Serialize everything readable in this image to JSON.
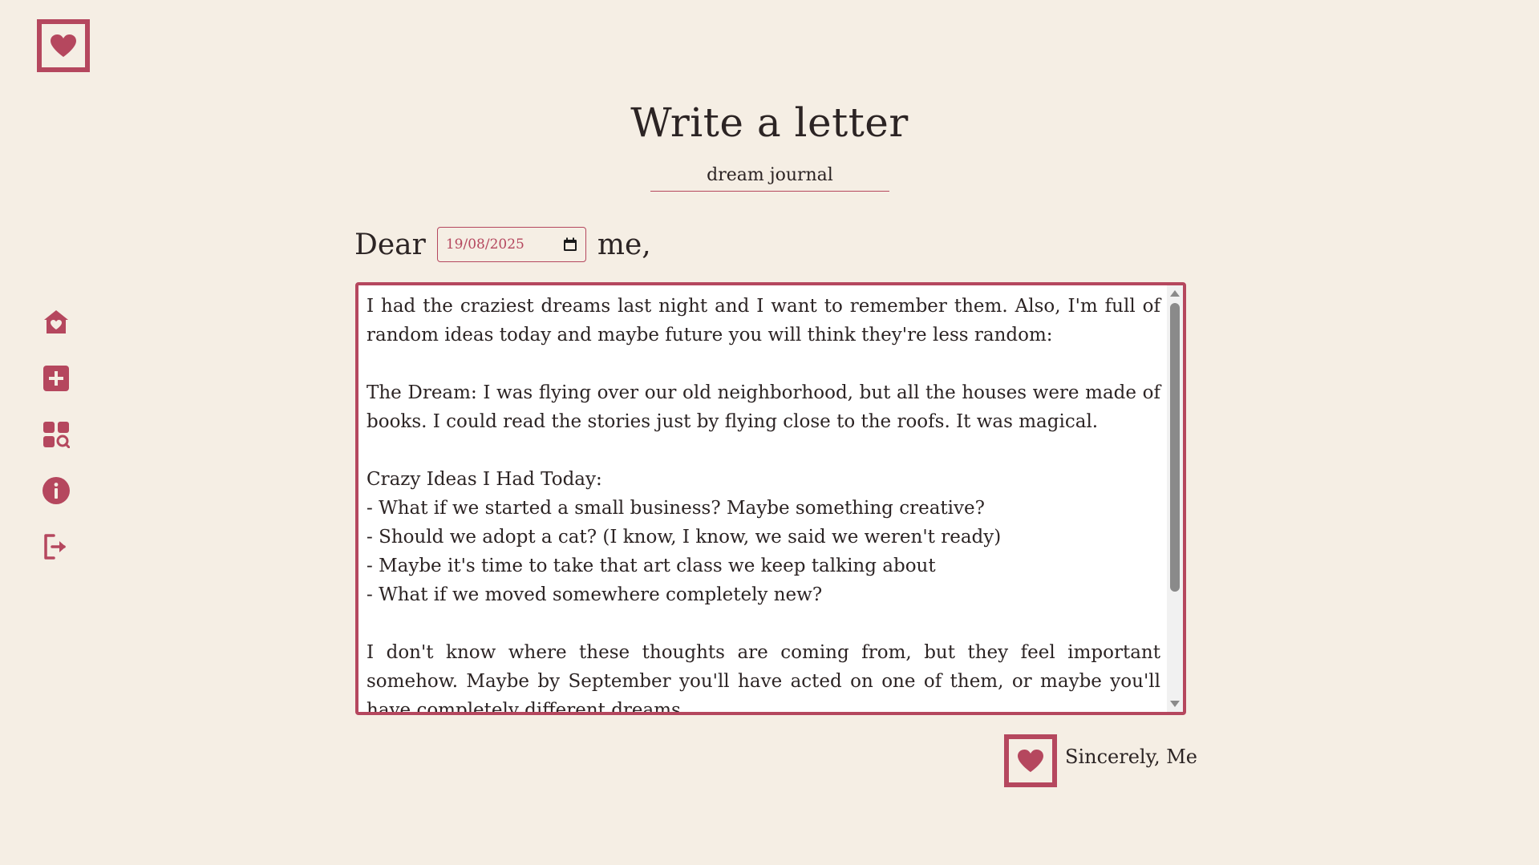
{
  "app": {
    "logo_icon": "heart-stamp-icon",
    "accent_color": "#b5475e",
    "background_color": "#f5eee4"
  },
  "sidebar": {
    "items": [
      {
        "icon": "home-heart-icon",
        "label": "Home"
      },
      {
        "icon": "add-square-icon",
        "label": "New letter"
      },
      {
        "icon": "grid-search-icon",
        "label": "Browse letters"
      },
      {
        "icon": "info-icon",
        "label": "About"
      },
      {
        "icon": "logout-icon",
        "label": "Log out"
      }
    ]
  },
  "header": {
    "title": "Write a letter",
    "subject_value": "dream journal"
  },
  "salutation": {
    "dear_text": "Dear",
    "date_value": "19/08/2025",
    "recipient_text": "me,"
  },
  "letter": {
    "body": "I had the craziest dreams last night and I want to remember them. Also, I'm full of random ideas today and maybe future you will think they're less random:\n\nThe Dream: I was flying over our old neighborhood, but all the houses were made of books. I could read the stories just by flying close to the roofs. It was magical.\n\nCrazy Ideas I Had Today:\n- What if we started a small business? Maybe something creative?\n- Should we adopt a cat? (I know, I know, we said we weren't ready)\n- Maybe it's time to take that art class we keep talking about\n- What if we moved somewhere completely new?\n\nI don't know where these thoughts are coming from, but they feel important somehow. Maybe by September you'll have acted on one of them, or maybe you'll have completely different dreams."
  },
  "signature": {
    "stamp_icon": "heart-stamp-icon",
    "text": "Sincerely, Me"
  }
}
